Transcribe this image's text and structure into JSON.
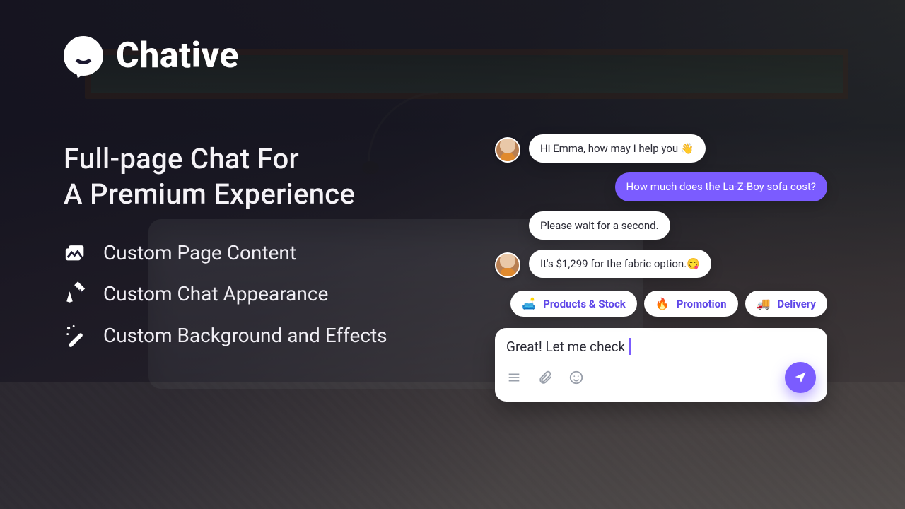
{
  "brand": {
    "name": "Chative"
  },
  "headline": {
    "line1": "Full-page Chat For",
    "line2": "A Premium Experience"
  },
  "features": [
    {
      "icon": "images-icon",
      "label": "Custom Page Content"
    },
    {
      "icon": "pencil-ruler-icon",
      "label": "Custom Chat Appearance"
    },
    {
      "icon": "magic-wand-icon",
      "label": "Custom Background and Effects"
    }
  ],
  "chat": {
    "messages": [
      {
        "from": "agent",
        "text": "Hi Emma, how may I help you 👋"
      },
      {
        "from": "me",
        "text": "How much does the La-Z-Boy sofa cost?"
      },
      {
        "from": "agent",
        "text": "Please wait for a second."
      },
      {
        "from": "agent",
        "text": "It's $1,299 for the fabric option.😋"
      }
    ],
    "chips": [
      {
        "emoji": "🛋️",
        "label": "Products & Stock"
      },
      {
        "emoji": "🔥",
        "label": "Promotion"
      },
      {
        "emoji": "🚚",
        "label": "Delivery"
      }
    ],
    "composer": {
      "draft": "Great! Let me check"
    },
    "accent": "#7b5cff"
  }
}
